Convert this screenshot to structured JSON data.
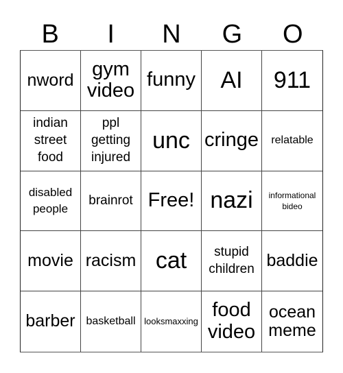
{
  "header": {
    "letters": [
      "B",
      "I",
      "N",
      "G",
      "O"
    ]
  },
  "board": {
    "cells": [
      {
        "text": "nword",
        "size": "s-m"
      },
      {
        "text": "gym video",
        "size": "s-l"
      },
      {
        "text": "funny",
        "size": "s-l"
      },
      {
        "text": "AI",
        "size": "s-xl"
      },
      {
        "text": "911",
        "size": "s-xl"
      },
      {
        "text": "indian street food",
        "size": "s-s"
      },
      {
        "text": "ppl getting injured",
        "size": "s-s"
      },
      {
        "text": "unc",
        "size": "s-xl"
      },
      {
        "text": "cringe",
        "size": "s-l"
      },
      {
        "text": "relatable",
        "size": "s-xs"
      },
      {
        "text": "disabled people",
        "size": "s-sm"
      },
      {
        "text": "brainrot",
        "size": "s-s"
      },
      {
        "text": "Free!",
        "size": "s-l"
      },
      {
        "text": "nazi",
        "size": "s-xl"
      },
      {
        "text": "informational bideo",
        "size": "s-tiny"
      },
      {
        "text": "movie",
        "size": "s-m"
      },
      {
        "text": "racism",
        "size": "s-m"
      },
      {
        "text": "cat",
        "size": "s-xl"
      },
      {
        "text": "stupid children",
        "size": "s-s"
      },
      {
        "text": "baddie",
        "size": "s-m"
      },
      {
        "text": "barber",
        "size": "s-m"
      },
      {
        "text": "basketball",
        "size": "s-xs"
      },
      {
        "text": "looksmaxxing",
        "size": "s-xxs"
      },
      {
        "text": "food video",
        "size": "s-l"
      },
      {
        "text": "ocean meme",
        "size": "s-m"
      }
    ]
  }
}
